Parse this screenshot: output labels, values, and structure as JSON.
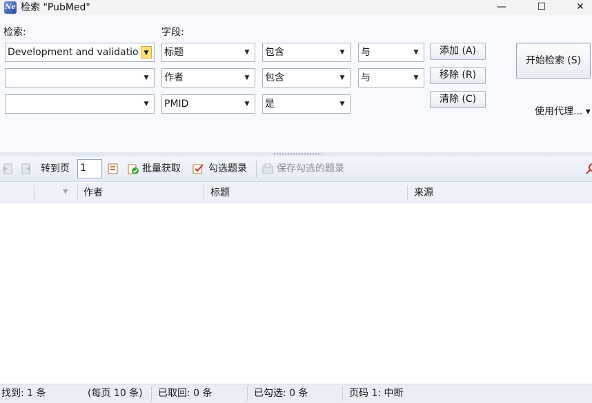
{
  "window": {
    "icon_text": "Ne",
    "title": "检索 \"PubMed\"",
    "minimize_glyph": "—",
    "maximize_glyph": "☐",
    "close_glyph": "✕"
  },
  "search": {
    "search_label": "检索:",
    "field_label": "字段:",
    "rows": [
      {
        "term": "Development and validatio",
        "field": "标题",
        "condition": "包含",
        "logic": "与"
      },
      {
        "term": "",
        "field": "作者",
        "condition": "包含",
        "logic": "与"
      },
      {
        "term": "",
        "field": "PMID",
        "condition": "是"
      }
    ],
    "add_button": "添加 (A)",
    "remove_button": "移除 (R)",
    "clear_button": "清除 (C)",
    "start_button": "开始检索 (S)",
    "proxy_label": "使用代理... ▾"
  },
  "toolbar": {
    "goto_label": "转到页",
    "page_value": "1",
    "batch_label": "批量获取",
    "check_label": "勾选题录",
    "save_label": "保存勾选的题录"
  },
  "grid": {
    "columns": [
      "作者",
      "标题",
      "来源"
    ]
  },
  "status": {
    "found": "找到: 1 条",
    "per_page": "(每页 10 条)",
    "retrieved": "已取回: 0 条",
    "checked": "已勾选: 0 条",
    "page": "页码 1: 中断"
  },
  "colors": {
    "accent": "#ffe27a",
    "panel_bg": "#f7f9fd",
    "toolbar_bg": "#e6ecf5"
  },
  "icons": {
    "prev": "page-back-icon",
    "next": "page-forward-icon",
    "goto": "goto-page-icon",
    "batch": "batch-fetch-icon",
    "check": "check-records-icon",
    "save": "save-records-icon",
    "search": "search-tool-icon"
  }
}
